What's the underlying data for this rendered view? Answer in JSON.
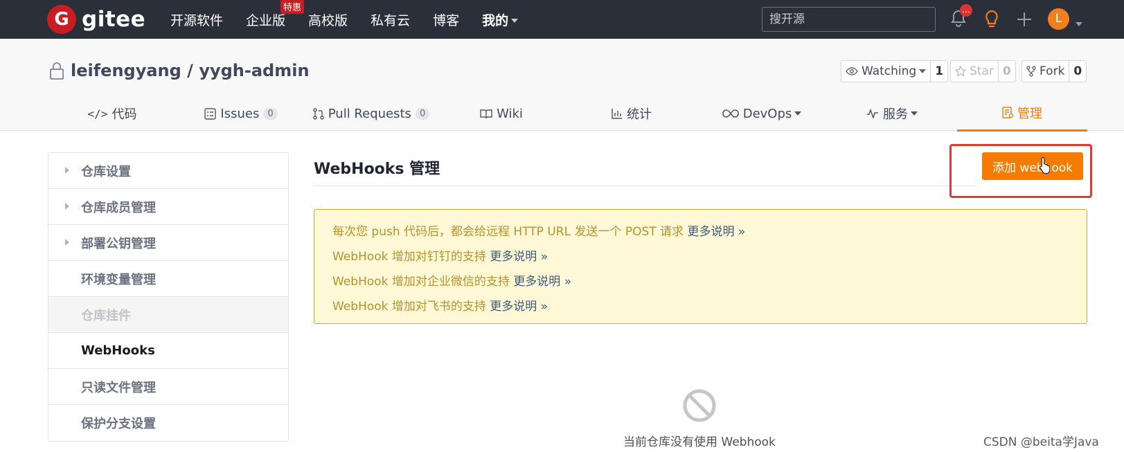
{
  "topbar": {
    "brand": "gitee",
    "brand_mark": "G",
    "nav": [
      {
        "label": "开源软件"
      },
      {
        "label": "企业版",
        "badge": "特惠"
      },
      {
        "label": "高校版"
      },
      {
        "label": "私有云"
      },
      {
        "label": "博客"
      },
      {
        "label": "我的"
      }
    ],
    "search_placeholder": "搜开源",
    "notification_badge": "…",
    "avatar_letter": "L"
  },
  "repo": {
    "owner": "leifengyang",
    "separator": " / ",
    "name": "yygh-admin",
    "watch": {
      "label": "Watching",
      "count": "1"
    },
    "star": {
      "label": "Star",
      "count": "0"
    },
    "fork": {
      "label": "Fork",
      "count": "0"
    }
  },
  "tabs": [
    {
      "label": "代码",
      "icon": "code-icon"
    },
    {
      "label": "Issues",
      "count": "0",
      "icon": "issues-icon"
    },
    {
      "label": "Pull Requests",
      "count": "0",
      "icon": "pull-request-icon"
    },
    {
      "label": "Wiki",
      "icon": "book-icon"
    },
    {
      "label": "统计",
      "icon": "bar-chart-icon"
    },
    {
      "label": "DevOps",
      "icon": "infinity-icon"
    },
    {
      "label": "服务",
      "icon": "pulse-icon"
    },
    {
      "label": "管理",
      "icon": "manage-icon",
      "active": true
    }
  ],
  "sidebar": {
    "items": [
      {
        "label": "仓库设置"
      },
      {
        "label": "仓库成员管理"
      },
      {
        "label": "部署公钥管理"
      },
      {
        "label": "环境变量管理"
      },
      {
        "label": "仓库挂件"
      },
      {
        "label": "WebHooks"
      },
      {
        "label": "只读文件管理"
      },
      {
        "label": "保护分支设置"
      }
    ]
  },
  "main": {
    "heading": "WebHooks 管理",
    "add_button": "添加 webhook",
    "notice": [
      {
        "text": "每次您 push 代码后，都会给远程 HTTP URL 发送一个 POST 请求 ",
        "more": "更多说明 »"
      },
      {
        "text": "WebHook 增加对钉钉的支持 ",
        "more": "更多说明 »"
      },
      {
        "text": "WebHook 增加对企业微信的支持 ",
        "more": "更多说明 »"
      },
      {
        "text": "WebHook 增加对飞书的支持 ",
        "more": "更多说明 »"
      }
    ],
    "empty_text": "当前仓库没有使用 Webhook"
  },
  "watermark": "CSDN @beita学Java",
  "colors": {
    "topbar": "#2b2f3a",
    "brand_red": "#c71d23",
    "accent_orange": "#f57c00",
    "highlight_red": "#e53935",
    "notice_bg": "#fff8d6"
  }
}
